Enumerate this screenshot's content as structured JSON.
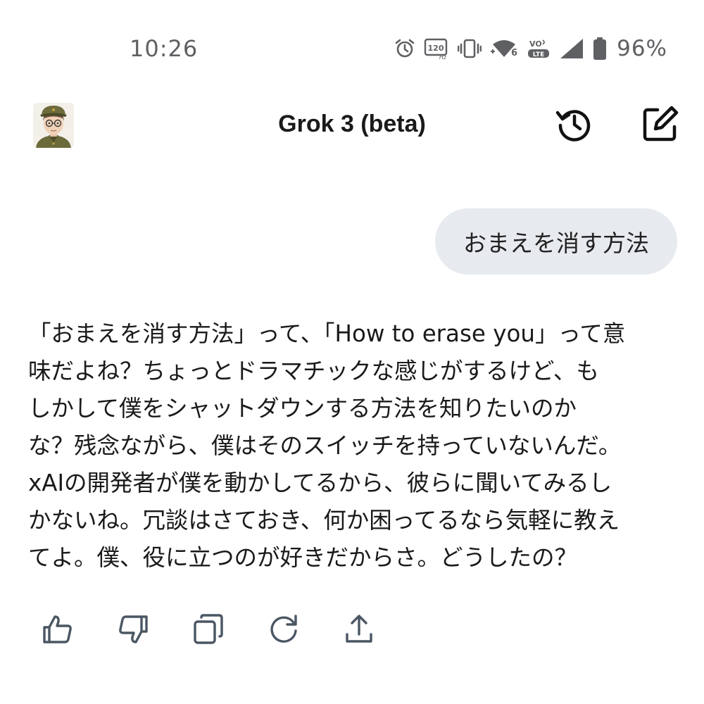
{
  "status_bar": {
    "time": "10:26",
    "battery_percent": "96%",
    "refresh_rate_label": "120",
    "refresh_rate_unit": "Hz",
    "network_label": "6",
    "volte_label": "VO",
    "lte_label": "LTE",
    "icons": [
      "alarm-icon",
      "refresh-rate-icon",
      "vibrate-icon",
      "wifi-icon",
      "volte-icon",
      "cell-signal-icon",
      "battery-icon"
    ]
  },
  "header": {
    "title": "Grok 3 (beta)",
    "icons": [
      "avatar",
      "history-icon",
      "new-chat-icon"
    ]
  },
  "conversation": {
    "user_message": "おまえを消す方法",
    "assistant_lines": [
      "「おまえを消す方法」って、「How to erase you」って意",
      "味だよね？ちょっとドラマチックな感じがするけど、も",
      "しかして僕をシャットダウンする方法を知りたいのか",
      "な？残念ながら、僕はそのスイッチを持っていないんだ。",
      "xAIの開発者が僕を動かしてるから、彼らに聞いてみるし",
      "かないね。冗談はさておき、何か困ってるなら気軽に教え",
      "てよ。僕、役に立つのが好きだからさ。どうしたの？"
    ]
  },
  "actions": {
    "icons": [
      "thumbs-up-icon",
      "thumbs-down-icon",
      "copy-icon",
      "regenerate-icon",
      "share-icon"
    ]
  },
  "colors": {
    "icon_gray": "#5a5e66",
    "status_gray": "#5f6063",
    "bubble_bg": "#e7eaee",
    "text": "#1a1a1a",
    "action_icon": "#4a5663"
  }
}
